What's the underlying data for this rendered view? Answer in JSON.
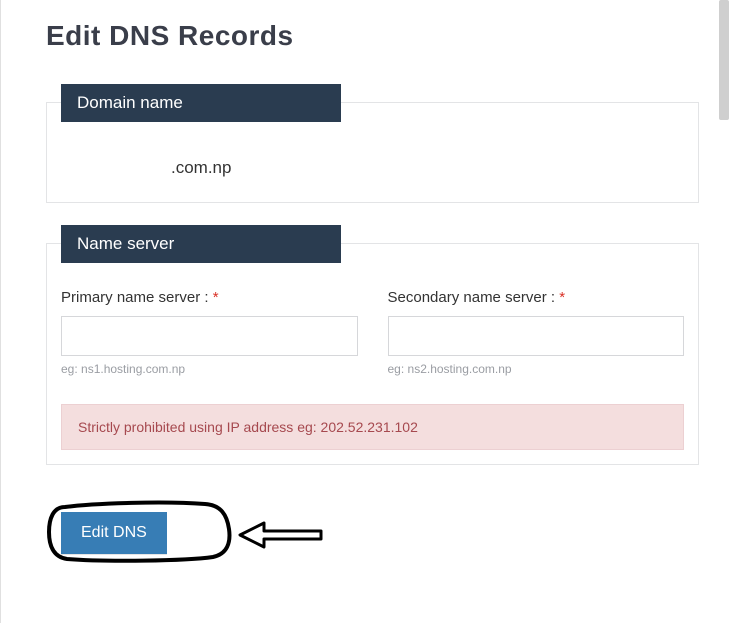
{
  "page": {
    "title": "Edit DNS Records"
  },
  "domain": {
    "legend": "Domain name",
    "value": ".com.np"
  },
  "nameserver": {
    "legend": "Name server",
    "primary": {
      "label": "Primary name server : ",
      "value": "",
      "hint": "eg: ns1.hosting.com.np"
    },
    "secondary": {
      "label": "Secondary name server : ",
      "value": "",
      "hint": "eg: ns2.hosting.com.np"
    },
    "warning": "Strictly prohibited using IP address eg: 202.52.231.102"
  },
  "actions": {
    "submit_label": "Edit DNS"
  },
  "required_marker": "*"
}
